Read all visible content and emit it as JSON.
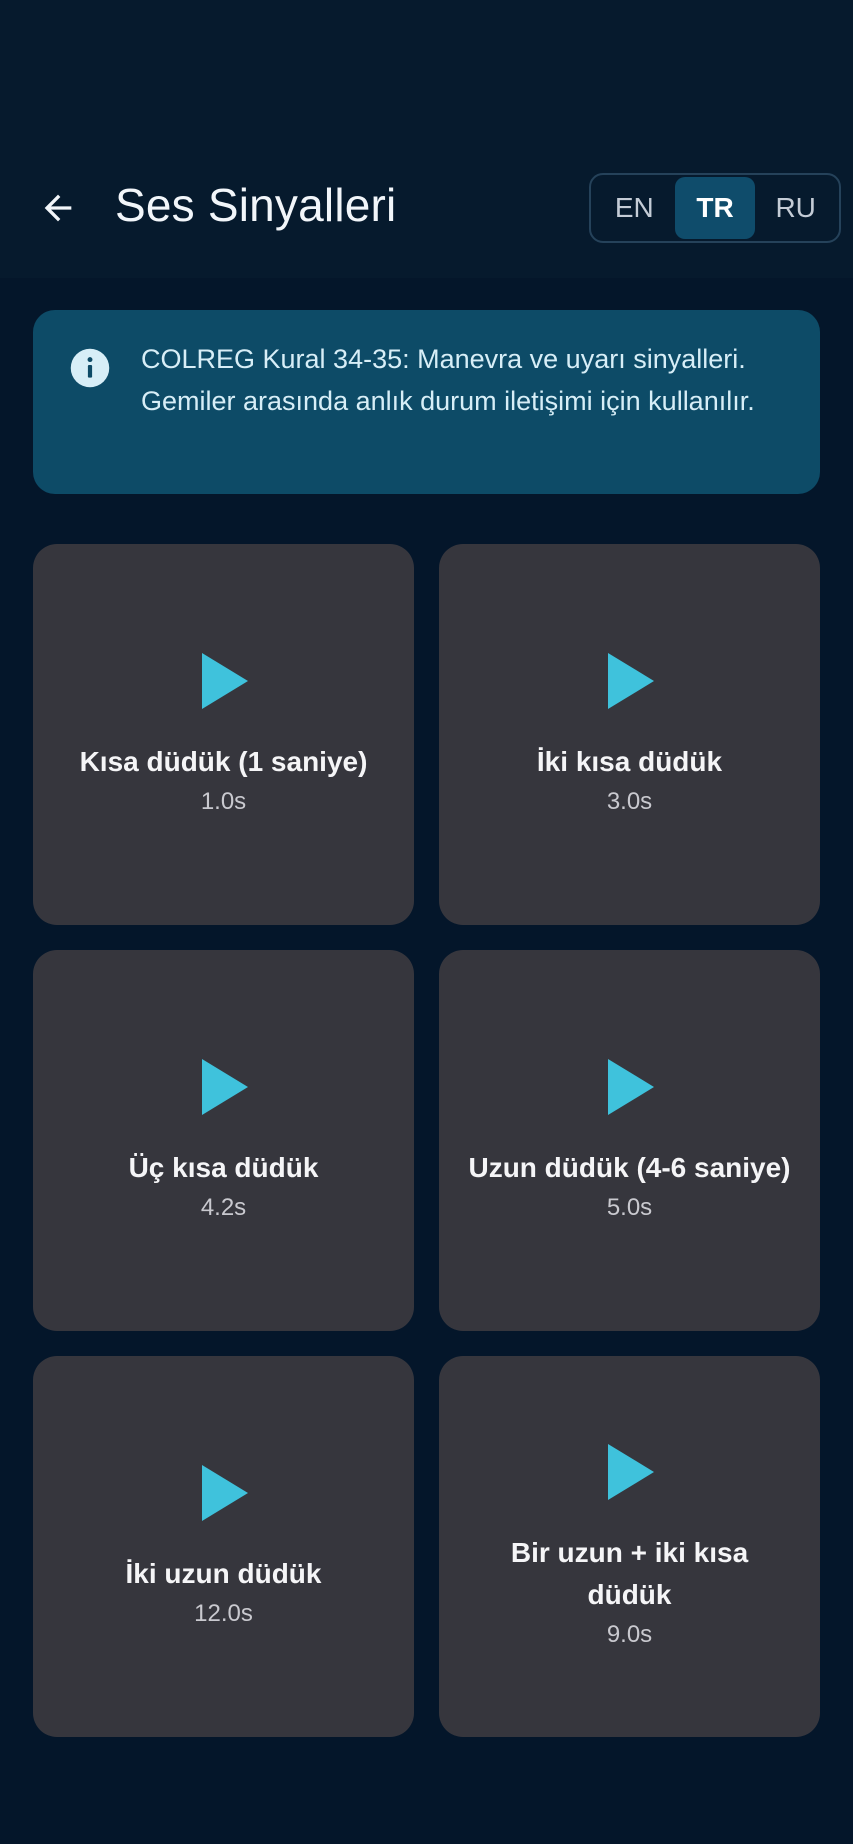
{
  "header": {
    "title": "Ses Sinyalleri",
    "back_icon": "arrow-left-icon",
    "languages": [
      {
        "code": "EN",
        "active": false
      },
      {
        "code": "TR",
        "active": true
      },
      {
        "code": "RU",
        "active": false
      }
    ]
  },
  "info": {
    "icon": "info-icon",
    "text": "COLREG Kural 34-35: Manevra ve uyarı sinyalleri. Gemiler arasında anlık durum iletişimi için kullanılır."
  },
  "signals": [
    {
      "title": "Kısa düdük (1 saniye)",
      "duration": "1.0s",
      "icon": "play-icon"
    },
    {
      "title": "İki kısa düdük",
      "duration": "3.0s",
      "icon": "play-icon"
    },
    {
      "title": "Üç kısa düdük",
      "duration": "4.2s",
      "icon": "play-icon"
    },
    {
      "title": "Uzun düdük (4-6 saniye)",
      "duration": "5.0s",
      "icon": "play-icon"
    },
    {
      "title": "İki uzun düdük",
      "duration": "12.0s",
      "icon": "play-icon"
    },
    {
      "title": "Bir uzun + iki kısa düdük",
      "duration": "9.0s",
      "icon": "play-icon"
    }
  ],
  "colors": {
    "background": "#04162a",
    "app_bar": "#061a2d",
    "card": "#36363d",
    "info_banner": "#0d4b67",
    "accent": "#3fc2dc",
    "active_lang": "#0f4c6b"
  }
}
